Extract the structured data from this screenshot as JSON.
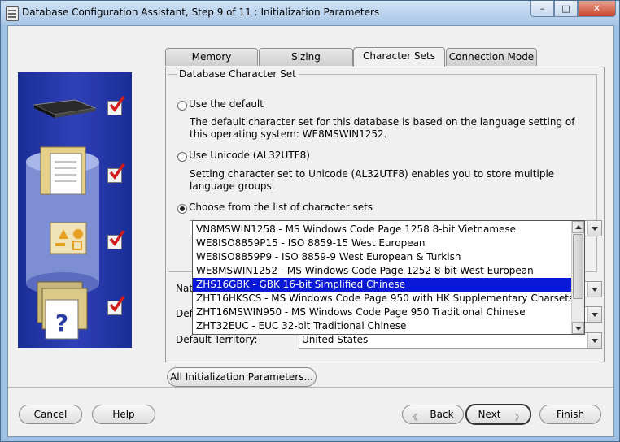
{
  "window": {
    "title": "Database Configuration Assistant, Step 9 of 11 : Initialization Parameters",
    "controls": {
      "minimize": "–",
      "maximize": "□",
      "close": "✕"
    }
  },
  "tabs": [
    {
      "label": "Memory",
      "active": false
    },
    {
      "label": "Sizing",
      "active": false
    },
    {
      "label": "Character Sets",
      "active": true
    },
    {
      "label": "Connection Mode",
      "active": false
    }
  ],
  "charset_group": {
    "label": "Database Character Set",
    "options": [
      {
        "label": "Use the default",
        "checked": false,
        "description": "The default character set for this database is based on the language setting of this operating system: WE8MSWIN1252."
      },
      {
        "label": "Use Unicode (AL32UTF8)",
        "checked": false,
        "description": "Setting character set to Unicode (AL32UTF8) enables you to store multiple language groups."
      },
      {
        "label": "Choose from the list of character sets",
        "checked": true,
        "description": ""
      }
    ]
  },
  "charset_list": {
    "selected_index": 4,
    "items": [
      "VN8MSWIN1258 - MS Windows Code Page 1258 8-bit Vietnamese",
      "WE8ISO8859P15 - ISO 8859-15 West European",
      "WE8ISO8859P9 - ISO 8859-9 West European & Turkish",
      "WE8MSWIN1252 - MS Windows Code Page 1252 8-bit West European",
      "ZHS16GBK - GBK 16-bit Simplified Chinese",
      "ZHT16HKSCS - MS Windows Code Page 950 with HK Supplementary Charsets",
      "ZHT16MSWIN950 - MS Windows Code Page 950 Traditional Chinese",
      "ZHT32EUC - EUC 32-bit Traditional Chinese"
    ],
    "scroll_position": 0.95
  },
  "fields": {
    "national_label": "Nat",
    "default_language_label": "Def",
    "default_territory_label": "Default Territory:",
    "default_territory_value": "United States"
  },
  "all_params_button": "All Initialization Parameters...",
  "footer": {
    "cancel": "Cancel",
    "help": "Help",
    "back": "Back",
    "next": "Next",
    "finish": "Finish"
  },
  "colors": {
    "selection": "#0a18d8",
    "left_panel": "#1a2d96",
    "check_mark": "#d21b1b"
  }
}
